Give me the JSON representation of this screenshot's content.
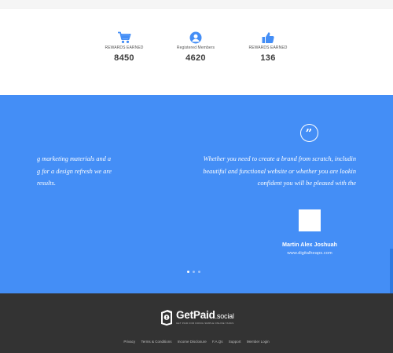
{
  "stats": [
    {
      "icon": "cart-icon",
      "label": "REWARDS EARNED",
      "value": "8450"
    },
    {
      "icon": "user-circle-icon",
      "label": "Registered Members",
      "value": "4620"
    },
    {
      "icon": "thumbs-up-icon",
      "label": "REWARDS EARNED",
      "value": "136"
    }
  ],
  "testimonials": {
    "quote_glyph": "”",
    "prev_slide_lines": [
      "g marketing materials and a",
      "g for a design refresh we are",
      " results."
    ],
    "current_slide_lines": [
      "Whether you need to create a brand from scratch, includin",
      "beautiful and functional website or whether you are lookin",
      "confident you will be pleased with the"
    ],
    "author": "Martin Alex Joshuah",
    "site": "www.digitalheaps.com",
    "slide_count": 3,
    "active_slide": 1
  },
  "footer": {
    "logo_text": "GetPaid",
    "logo_domain": ".social",
    "logo_tagline": "GET PAID FOR DOING SIMPLE ONLINE TASKS",
    "links": [
      "Privacy",
      "Terms & Conditions",
      "Income Disclosure",
      "F.A.Qs",
      "Support",
      "Member Login"
    ]
  },
  "colors": {
    "accent": "#448ef6",
    "stat_icon": "#448ef6",
    "footer_bg": "#333333"
  }
}
